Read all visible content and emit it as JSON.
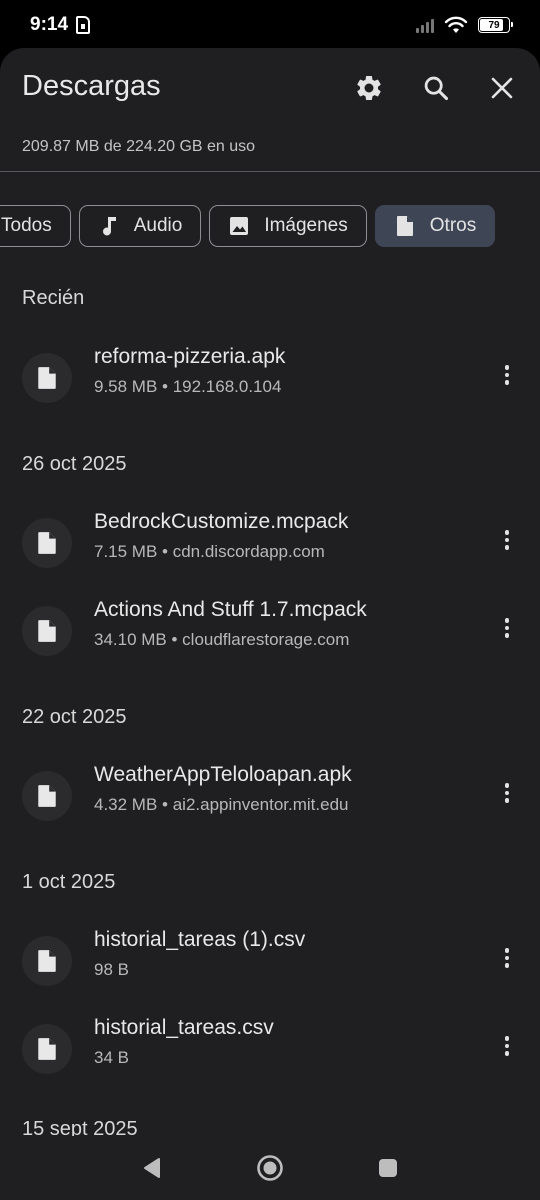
{
  "status_bar": {
    "time": "9:14",
    "battery_level": "79"
  },
  "header": {
    "title": "Descargas",
    "settings_icon": "gear-icon",
    "search_icon": "search-icon",
    "close_icon": "close-icon"
  },
  "storage": {
    "usage_text": "209.87 MB de 224.20 GB en uso"
  },
  "filters": [
    {
      "label": "Todos",
      "icon": "",
      "active": false
    },
    {
      "label": "Audio",
      "icon": "music-note-icon",
      "active": false
    },
    {
      "label": "Imágenes",
      "icon": "image-icon",
      "active": false
    },
    {
      "label": "Otros",
      "icon": "file-icon",
      "active": true
    }
  ],
  "sections": [
    {
      "title": "Recién",
      "items": [
        {
          "name": "reforma-pizzeria.apk",
          "meta": "9.58 MB • 192.168.0.104"
        }
      ]
    },
    {
      "title": "26 oct 2025",
      "items": [
        {
          "name": "BedrockCustomize.mcpack",
          "meta": "7.15 MB • cdn.discordapp.com"
        },
        {
          "name": "Actions And Stuff 1.7.mcpack",
          "meta": "34.10 MB • cloudflarestorage.com"
        }
      ]
    },
    {
      "title": "22 oct 2025",
      "items": [
        {
          "name": "WeatherAppTeloloapan.apk",
          "meta": "4.32 MB • ai2.appinventor.mit.edu"
        }
      ]
    },
    {
      "title": "1 oct 2025",
      "items": [
        {
          "name": "historial_tareas (1).csv",
          "meta": "98 B"
        },
        {
          "name": "historial_tareas.csv",
          "meta": "34 B"
        }
      ]
    },
    {
      "title": "15 sept 2025",
      "items": []
    }
  ],
  "colors": {
    "sheet_bg": "#1f1f21",
    "active_chip": "#3e4555",
    "text": "#e3e3e3"
  }
}
